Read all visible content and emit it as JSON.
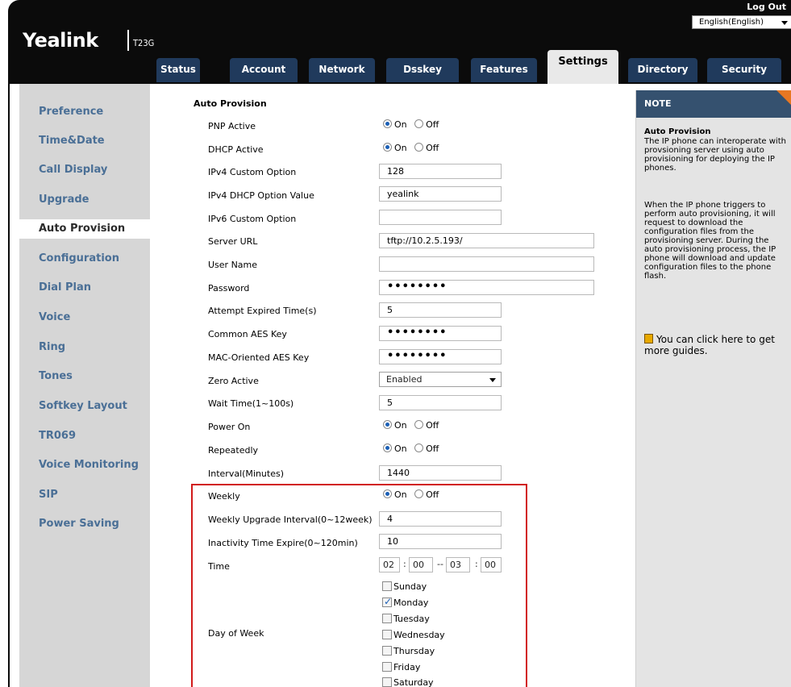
{
  "header": {
    "logo_text": "Yealink",
    "model": "T23G",
    "logout": "Log Out",
    "language": "English(English)",
    "tabs": [
      {
        "label": "Status"
      },
      {
        "label": "Account"
      },
      {
        "label": "Network"
      },
      {
        "label": "Dsskey"
      },
      {
        "label": "Features"
      },
      {
        "label": "Settings"
      },
      {
        "label": "Directory"
      },
      {
        "label": "Security"
      }
    ],
    "active_tab": "Settings"
  },
  "sidebar": {
    "items": [
      {
        "label": "Preference"
      },
      {
        "label": "Time&Date"
      },
      {
        "label": "Call Display"
      },
      {
        "label": "Upgrade"
      },
      {
        "label": "Auto Provision"
      },
      {
        "label": "Configuration"
      },
      {
        "label": "Dial Plan"
      },
      {
        "label": "Voice"
      },
      {
        "label": "Ring"
      },
      {
        "label": "Tones"
      },
      {
        "label": "Softkey Layout"
      },
      {
        "label": "TR069"
      },
      {
        "label": "Voice Monitoring"
      },
      {
        "label": "SIP"
      },
      {
        "label": "Power Saving"
      }
    ],
    "active_item": "Auto Provision"
  },
  "form": {
    "section_title": "Auto Provision",
    "radio_on": "On",
    "radio_off": "Off",
    "pnp_active": {
      "label": "PNP Active",
      "value": "On"
    },
    "dhcp_active": {
      "label": "DHCP Active",
      "value": "On"
    },
    "ipv4_custom_option": {
      "label": "IPv4 Custom Option",
      "value": "128"
    },
    "ipv4_dhcp_option_value": {
      "label": "IPv4 DHCP Option Value",
      "value": "yealink"
    },
    "ipv6_custom_option": {
      "label": "IPv6 Custom Option",
      "value": ""
    },
    "server_url": {
      "label": "Server URL",
      "value": "tftp://10.2.5.193/"
    },
    "user_name": {
      "label": "User Name",
      "value": ""
    },
    "password": {
      "label": "Password",
      "value": "••••••••"
    },
    "attempt_expired_time": {
      "label": "Attempt Expired Time(s)",
      "value": "5"
    },
    "common_aes_key": {
      "label": "Common AES Key",
      "value": "••••••••"
    },
    "mac_oriented_aes_key": {
      "label": "MAC-Oriented AES Key",
      "value": "••••••••"
    },
    "zero_active": {
      "label": "Zero Active",
      "value": "Enabled"
    },
    "wait_time": {
      "label": "Wait Time(1~100s)",
      "value": "5"
    },
    "power_on": {
      "label": "Power On",
      "value": "On"
    },
    "repeatedly": {
      "label": "Repeatedly",
      "value": "On"
    },
    "interval": {
      "label": "Interval(Minutes)",
      "value": "1440"
    },
    "weekly": {
      "label": "Weekly",
      "value": "On"
    },
    "weekly_upgrade_interval": {
      "label": "Weekly Upgrade Interval(0~12week)",
      "value": "4"
    },
    "inactivity_time_expire": {
      "label": "Inactivity Time Expire(0~120min)",
      "value": "10"
    },
    "time": {
      "label": "Time",
      "start_hour": "02",
      "start_min": "00",
      "end_hour": "03",
      "end_min": "00",
      "colon": ":",
      "dash": "--"
    },
    "day_of_week": {
      "label": "Day of Week",
      "days": [
        {
          "label": "Sunday",
          "checked": false
        },
        {
          "label": "Monday",
          "checked": true
        },
        {
          "label": "Tuesday",
          "checked": false
        },
        {
          "label": "Wednesday",
          "checked": false
        },
        {
          "label": "Thursday",
          "checked": false
        },
        {
          "label": "Friday",
          "checked": false
        },
        {
          "label": "Saturday",
          "checked": false
        }
      ]
    }
  },
  "note": {
    "header": "NOTE",
    "title": "Auto Provision",
    "para1": "The IP phone can interoperate with provsioning server using auto provisioning for deploying the IP phones.",
    "para2": "When the IP phone triggers to perform auto provisioning, it will request to download the configuration files from the provisioning server. During the auto provisioning process, the IP phone will download and update configuration files to the phone flash.",
    "guide": "You can click here to get more guides."
  },
  "colors": {
    "header_bg": "#0b0b0b",
    "tab_navy": "#203a5c",
    "sidebar_bg": "#d6d6d6",
    "sidebar_link": "#4a6f96",
    "note_header": "#35516f",
    "note_corner": "#e87722",
    "highlight_border": "#d11a1a"
  }
}
